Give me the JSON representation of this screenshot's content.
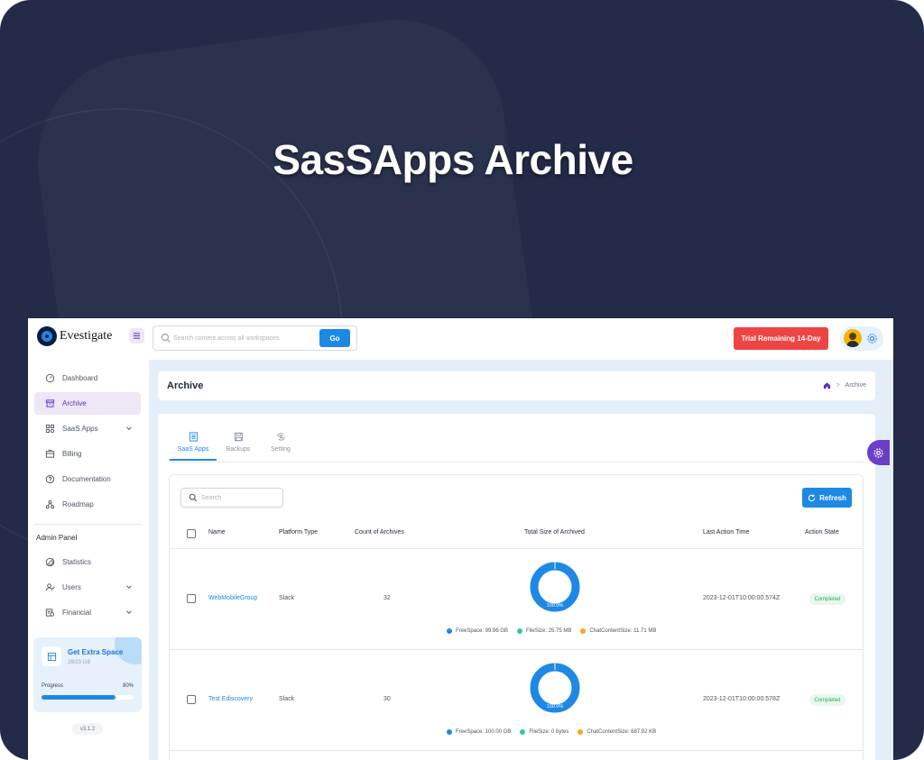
{
  "hero": {
    "title": "SasSApps Archive"
  },
  "brand": {
    "name": "Evestigate"
  },
  "topbar": {
    "search_placeholder": "Search content across all workspaces",
    "go_label": "Go",
    "trial_label": "Trial Remaining 14-Day"
  },
  "sidebar": {
    "items": [
      {
        "label": "Dashboard",
        "icon": "dashboard-icon"
      },
      {
        "label": "Archive",
        "icon": "archive-icon",
        "active": true
      },
      {
        "label": "SaaS Apps",
        "icon": "apps-icon",
        "expandable": true
      },
      {
        "label": "Billing",
        "icon": "billing-icon"
      },
      {
        "label": "Documentation",
        "icon": "help-icon"
      },
      {
        "label": "Roadmap",
        "icon": "roadmap-icon"
      }
    ],
    "admin_section": "Admin Panel",
    "admin_items": [
      {
        "label": "Statistics",
        "icon": "statistics-icon"
      },
      {
        "label": "Users",
        "icon": "users-icon",
        "expandable": true
      },
      {
        "label": "Financial",
        "icon": "financial-icon",
        "expandable": true
      }
    ],
    "extra_space": {
      "title": "Get Extra Space",
      "subtitle": "28/23 GB",
      "progress_label": "Progress",
      "progress_value": "80%",
      "progress_fraction": 0.8
    },
    "version": "v3.1.2"
  },
  "page": {
    "title": "Archive",
    "breadcrumb": [
      "home",
      "Archive"
    ]
  },
  "tabs": [
    {
      "label": "SaaS Apps",
      "icon": "list-icon",
      "active": true
    },
    {
      "label": "Backups",
      "icon": "backup-icon"
    },
    {
      "label": "Setting",
      "icon": "settings-sync-icon"
    }
  ],
  "table": {
    "search_placeholder": "Search",
    "refresh_label": "Refresh",
    "columns": [
      "Name",
      "Platform Type",
      "Count of Archives",
      "Total Size of Archived",
      "Last Action Time",
      "Action State"
    ],
    "rows": [
      {
        "name": "WebMobileGroup",
        "platform": "Slack",
        "count": "32",
        "donut_label": "100.0%",
        "legend": [
          "FreeSpace: 99.96 GB",
          "FileSize: 25.75 MB",
          "ChatContentSize: 11.71 MB"
        ],
        "last_action": "2023-12-01T10:00:00.574Z",
        "state": "Completed"
      },
      {
        "name": "Test Ediscovery",
        "platform": "Slack",
        "count": "30",
        "donut_label": "100.0%",
        "legend": [
          "FreeSpace: 100.00 GB",
          "FileSize: 0 bytes",
          "ChatContentSize: 687.92 KB"
        ],
        "last_action": "2023-12-01T10:00:00.578Z",
        "state": "Completed"
      }
    ]
  },
  "colors": {
    "primary": "#1e88e5",
    "accent_purple": "#6a3fc8",
    "trial_red": "#ef4444",
    "free_space": "#1e88e5",
    "file_size": "#2ecc9a",
    "chat_content": "#f5a623",
    "background": "#232b48"
  }
}
